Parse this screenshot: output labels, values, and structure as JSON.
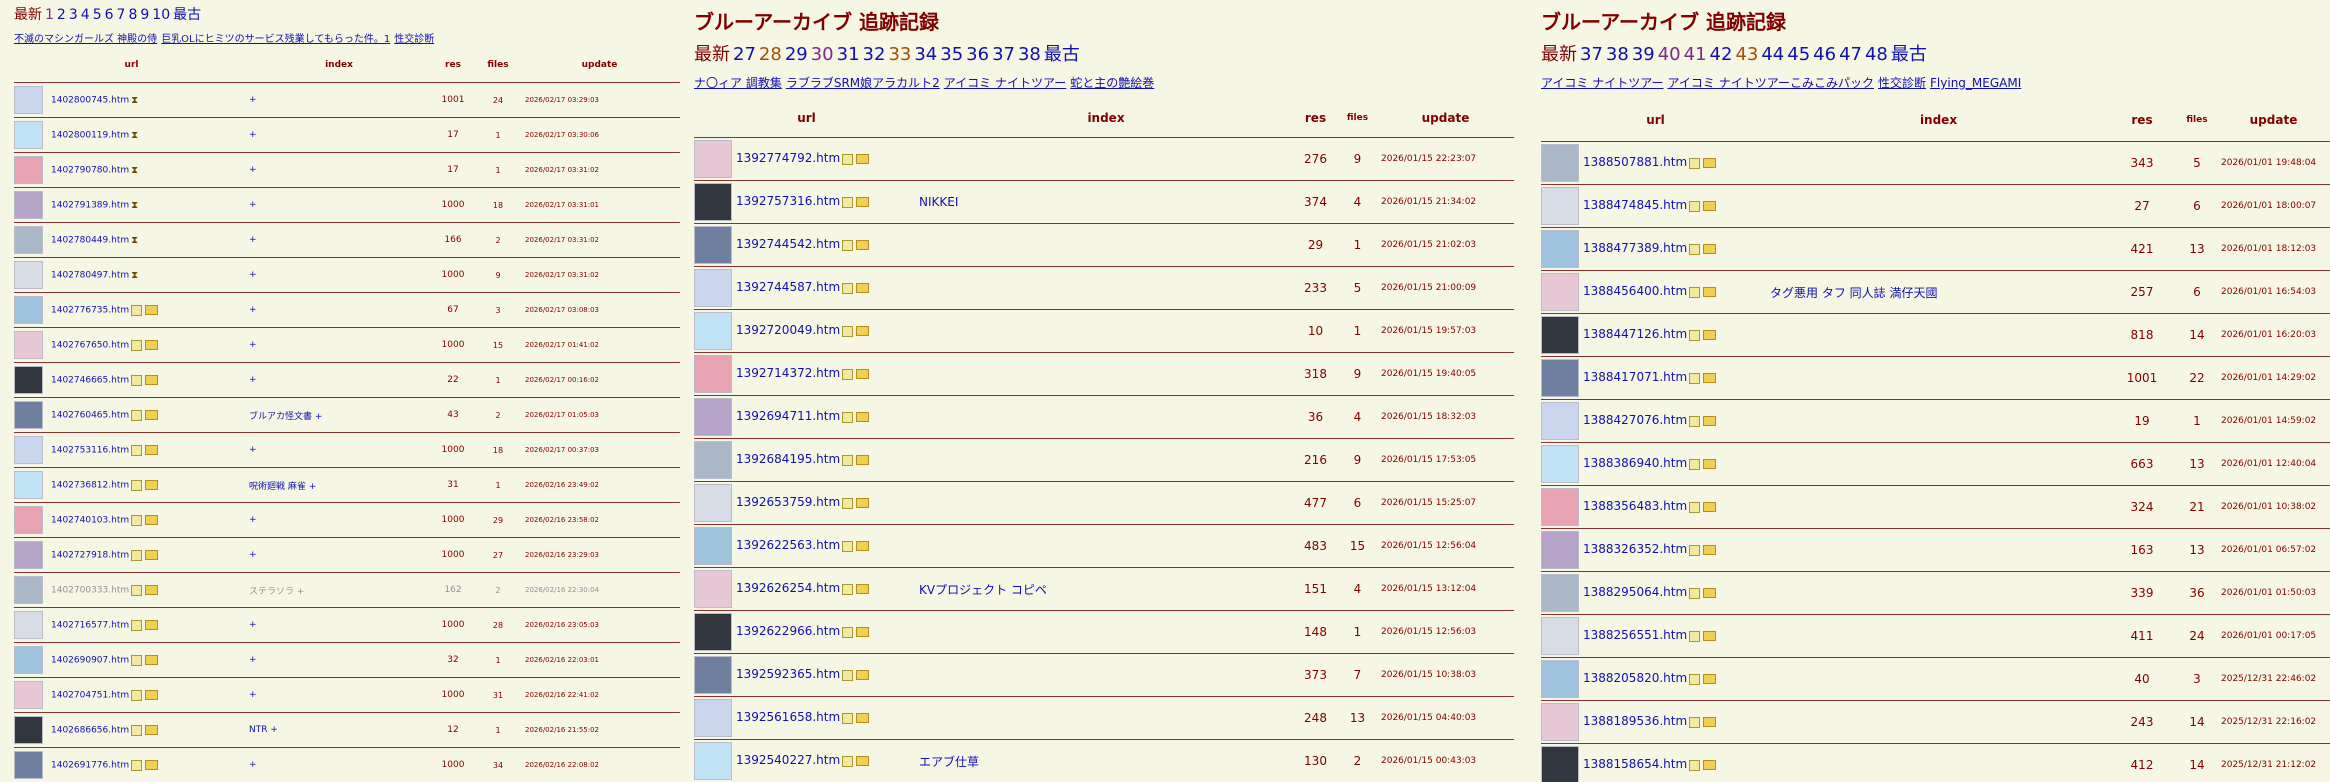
{
  "thumb_colors": [
    "#c9d6ee",
    "#e8c8d4",
    "#a9b7c9",
    "#bfe3f4",
    "#31363f",
    "#d7dce6",
    "#e8a3b2",
    "#6e7fa0",
    "#9fc3dd",
    "#b5a3c8"
  ],
  "panels": [
    {
      "id": "p1",
      "title": "",
      "pages_label": "最新",
      "pages": [
        {
          "n": "1",
          "state": "vis"
        },
        {
          "n": "2",
          "state": ""
        },
        {
          "n": "3",
          "state": ""
        },
        {
          "n": "4",
          "state": ""
        },
        {
          "n": "5",
          "state": ""
        },
        {
          "n": "6",
          "state": ""
        },
        {
          "n": "7",
          "state": ""
        },
        {
          "n": "8",
          "state": ""
        },
        {
          "n": "9",
          "state": ""
        },
        {
          "n": "10",
          "state": ""
        },
        {
          "n": "最古",
          "state": ""
        }
      ],
      "links": [
        "不滅のマシンガールズ 神殿の侍",
        "巨乳OLにヒミツのサービス残業してもらった件。1",
        "性交診断"
      ],
      "headers": {
        "url": "url",
        "index": "index",
        "res": "res",
        "files": "files",
        "update": "update"
      },
      "rows": [
        {
          "url": "1402800745.htm",
          "icons": "hour",
          "index": "+",
          "res": "1001",
          "files": "24",
          "date": "2026/02/17 03:29:03"
        },
        {
          "url": "1402800119.htm",
          "icons": "hour",
          "index": "+",
          "res": "17",
          "files": "1",
          "date": "2026/02/17 03:30:06"
        },
        {
          "url": "1402790780.htm",
          "icons": "hour",
          "index": "+",
          "res": "17",
          "files": "1",
          "date": "2026/02/17 03:31:02"
        },
        {
          "url": "1402791389.htm",
          "icons": "hour",
          "index": "+",
          "res": "1000",
          "files": "18",
          "date": "2026/02/17 03:31:01"
        },
        {
          "url": "1402780449.htm",
          "icons": "hour",
          "index": "+",
          "res": "166",
          "files": "2",
          "date": "2026/02/17 03:31:02"
        },
        {
          "url": "1402780497.htm",
          "icons": "hour",
          "index": "+",
          "res": "1000",
          "files": "9",
          "date": "2026/02/17 03:31:02"
        },
        {
          "url": "1402776735.htm",
          "icons": "lf",
          "index": "+",
          "res": "67",
          "files": "3",
          "date": "2026/02/17 03:08:03"
        },
        {
          "url": "1402767650.htm",
          "icons": "lf",
          "index": "+",
          "res": "1000",
          "files": "15",
          "date": "2026/02/17 01:41:02"
        },
        {
          "url": "1402746665.htm",
          "icons": "lf",
          "index": "+",
          "res": "22",
          "files": "1",
          "date": "2026/02/17 00:16:02"
        },
        {
          "url": "1402760465.htm",
          "icons": "lf",
          "index": "ブルアカ怪文書 +",
          "res": "43",
          "files": "2",
          "date": "2026/02/17 01:05:03"
        },
        {
          "url": "1402753116.htm",
          "icons": "lf",
          "index": "+",
          "res": "1000",
          "files": "18",
          "date": "2026/02/17 00:37:03"
        },
        {
          "url": "1402736812.htm",
          "icons": "lf",
          "index": "呪術廻戦 麻雀 +",
          "res": "31",
          "files": "1",
          "date": "2026/02/16 23:49:02"
        },
        {
          "url": "1402740103.htm",
          "icons": "lf",
          "index": "+",
          "res": "1000",
          "files": "29",
          "date": "2026/02/16 23:58:02"
        },
        {
          "url": "1402727918.htm",
          "icons": "lf",
          "index": "+",
          "res": "1000",
          "files": "27",
          "date": "2026/02/16 23:29:03"
        },
        {
          "url": "1402700333.htm",
          "icons": "lf",
          "index": "ステラソラ +",
          "res": "162",
          "files": "2",
          "date": "2026/02/16 22:30:04",
          "dim": true
        },
        {
          "url": "1402716577.htm",
          "icons": "lf",
          "index": "+",
          "res": "1000",
          "files": "28",
          "date": "2026/02/16 23:05:03"
        },
        {
          "url": "1402690907.htm",
          "icons": "lf",
          "index": "+",
          "res": "32",
          "files": "1",
          "date": "2026/02/16 22:03:01"
        },
        {
          "url": "1402704751.htm",
          "icons": "lf",
          "index": "+",
          "res": "1000",
          "files": "31",
          "date": "2026/02/16 22:41:02"
        },
        {
          "url": "1402686656.htm",
          "icons": "lf",
          "index": "NTR +",
          "res": "12",
          "files": "1",
          "date": "2026/02/16 21:55:02"
        },
        {
          "url": "1402691776.htm",
          "icons": "lf",
          "index": "+",
          "res": "1000",
          "files": "34",
          "date": "2026/02/16 22:08:02"
        }
      ]
    },
    {
      "id": "p2",
      "title": "ブルーアーカイブ 追跡記録",
      "pages_label": "最新",
      "pages": [
        {
          "n": "27",
          "state": ""
        },
        {
          "n": "28",
          "state": "cur"
        },
        {
          "n": "29",
          "state": ""
        },
        {
          "n": "30",
          "state": "vis"
        },
        {
          "n": "31",
          "state": ""
        },
        {
          "n": "32",
          "state": ""
        },
        {
          "n": "33",
          "state": "cur"
        },
        {
          "n": "34",
          "state": ""
        },
        {
          "n": "35",
          "state": ""
        },
        {
          "n": "36",
          "state": ""
        },
        {
          "n": "37",
          "state": ""
        },
        {
          "n": "38",
          "state": ""
        },
        {
          "n": "最古",
          "state": ""
        }
      ],
      "links": [
        "ナ〇ィア 調教集",
        "ラブラブSRM娘アラカルト2",
        "アイコミ ナイトツアー",
        "蛇と主の艶絵巻"
      ],
      "headers": {
        "url": "url",
        "index": "index",
        "res": "res",
        "files": "files",
        "update": "update"
      },
      "rows": [
        {
          "url": "1392774792.htm",
          "icons": "lf",
          "index": "",
          "res": "276",
          "files": "9",
          "date": "2026/01/15 22:23:07"
        },
        {
          "url": "1392757316.htm",
          "icons": "lf",
          "index": "NIKKEI",
          "res": "374",
          "files": "4",
          "date": "2026/01/15 21:34:02"
        },
        {
          "url": "1392744542.htm",
          "icons": "lf",
          "index": "",
          "res": "29",
          "files": "1",
          "date": "2026/01/15 21:02:03"
        },
        {
          "url": "1392744587.htm",
          "icons": "lf",
          "index": "",
          "res": "233",
          "files": "5",
          "date": "2026/01/15 21:00:09"
        },
        {
          "url": "1392720049.htm",
          "icons": "lf",
          "index": "",
          "res": "10",
          "files": "1",
          "date": "2026/01/15 19:57:03"
        },
        {
          "url": "1392714372.htm",
          "icons": "lf",
          "index": "",
          "res": "318",
          "files": "9",
          "date": "2026/01/15 19:40:05"
        },
        {
          "url": "1392694711.htm",
          "icons": "lf",
          "index": "",
          "res": "36",
          "files": "4",
          "date": "2026/01/15 18:32:03"
        },
        {
          "url": "1392684195.htm",
          "icons": "lf",
          "index": "",
          "res": "216",
          "files": "9",
          "date": "2026/01/15 17:53:05"
        },
        {
          "url": "1392653759.htm",
          "icons": "lf",
          "index": "",
          "res": "477",
          "files": "6",
          "date": "2026/01/15 15:25:07"
        },
        {
          "url": "1392622563.htm",
          "icons": "lf",
          "index": "",
          "res": "483",
          "files": "15",
          "date": "2026/01/15 12:56:04"
        },
        {
          "url": "1392626254.htm",
          "icons": "lf",
          "index": "KVプロジェクト コピペ",
          "res": "151",
          "files": "4",
          "date": "2026/01/15 13:12:04"
        },
        {
          "url": "1392622966.htm",
          "icons": "lf",
          "index": "",
          "res": "148",
          "files": "1",
          "date": "2026/01/15 12:56:03"
        },
        {
          "url": "1392592365.htm",
          "icons": "lf",
          "index": "",
          "res": "373",
          "files": "7",
          "date": "2026/01/15 10:38:03"
        },
        {
          "url": "1392561658.htm",
          "icons": "lf",
          "index": "",
          "res": "248",
          "files": "13",
          "date": "2026/01/15 04:40:03"
        },
        {
          "url": "1392540227.htm",
          "icons": "lf",
          "index": "エアブ仕草",
          "res": "130",
          "files": "2",
          "date": "2026/01/15 00:43:03"
        }
      ]
    },
    {
      "id": "p3",
      "title": "ブルーアーカイブ 追跡記録",
      "pages_label": "最新",
      "pages": [
        {
          "n": "37",
          "state": ""
        },
        {
          "n": "38",
          "state": ""
        },
        {
          "n": "39",
          "state": ""
        },
        {
          "n": "40",
          "state": "vis"
        },
        {
          "n": "41",
          "state": "vis"
        },
        {
          "n": "42",
          "state": ""
        },
        {
          "n": "43",
          "state": "cur"
        },
        {
          "n": "44",
          "state": ""
        },
        {
          "n": "45",
          "state": ""
        },
        {
          "n": "46",
          "state": ""
        },
        {
          "n": "47",
          "state": ""
        },
        {
          "n": "48",
          "state": ""
        },
        {
          "n": "最古",
          "state": ""
        }
      ],
      "links": [
        "アイコミ ナイトツアー",
        "アイコミ ナイトツアーこみこみパック",
        "性交診断",
        "Flying_MEGAMI"
      ],
      "headers": {
        "url": "url",
        "index": "index",
        "res": "res",
        "files": "files",
        "update": "update"
      },
      "rows": [
        {
          "url": "1388507881.htm",
          "icons": "lf",
          "index": "",
          "res": "343",
          "files": "5",
          "date": "2026/01/01 19:48:04"
        },
        {
          "url": "1388474845.htm",
          "icons": "lf",
          "index": "",
          "res": "27",
          "files": "6",
          "date": "2026/01/01 18:00:07"
        },
        {
          "url": "1388477389.htm",
          "icons": "lf",
          "index": "",
          "res": "421",
          "files": "13",
          "date": "2026/01/01 18:12:03"
        },
        {
          "url": "1388456400.htm",
          "icons": "lf",
          "index": "タグ悪用 タフ 同人誌 満仔天國",
          "res": "257",
          "files": "6",
          "date": "2026/01/01 16:54:03"
        },
        {
          "url": "1388447126.htm",
          "icons": "lf",
          "index": "",
          "res": "818",
          "files": "14",
          "date": "2026/01/01 16:20:03"
        },
        {
          "url": "1388417071.htm",
          "icons": "lf",
          "index": "",
          "res": "1001",
          "files": "22",
          "date": "2026/01/01 14:29:02"
        },
        {
          "url": "1388427076.htm",
          "icons": "lf",
          "index": "",
          "res": "19",
          "files": "1",
          "date": "2026/01/01 14:59:02"
        },
        {
          "url": "1388386940.htm",
          "icons": "lf",
          "index": "",
          "res": "663",
          "files": "13",
          "date": "2026/01/01 12:40:04"
        },
        {
          "url": "1388356483.htm",
          "icons": "lf",
          "index": "",
          "res": "324",
          "files": "21",
          "date": "2026/01/01 10:38:02"
        },
        {
          "url": "1388326352.htm",
          "icons": "lf",
          "index": "",
          "res": "163",
          "files": "13",
          "date": "2026/01/01 06:57:02"
        },
        {
          "url": "1388295064.htm",
          "icons": "lf",
          "index": "",
          "res": "339",
          "files": "36",
          "date": "2026/01/01 01:50:03"
        },
        {
          "url": "1388256551.htm",
          "icons": "lf",
          "index": "",
          "res": "411",
          "files": "24",
          "date": "2026/01/01 00:17:05"
        },
        {
          "url": "1388205820.htm",
          "icons": "lf",
          "index": "",
          "res": "40",
          "files": "3",
          "date": "2025/12/31 22:46:02"
        },
        {
          "url": "1388189536.htm",
          "icons": "lf",
          "index": "",
          "res": "243",
          "files": "14",
          "date": "2025/12/31 22:16:02"
        },
        {
          "url": "1388158654.htm",
          "icons": "lf",
          "index": "",
          "res": "412",
          "files": "14",
          "date": "2025/12/31 21:12:02"
        }
      ]
    }
  ]
}
